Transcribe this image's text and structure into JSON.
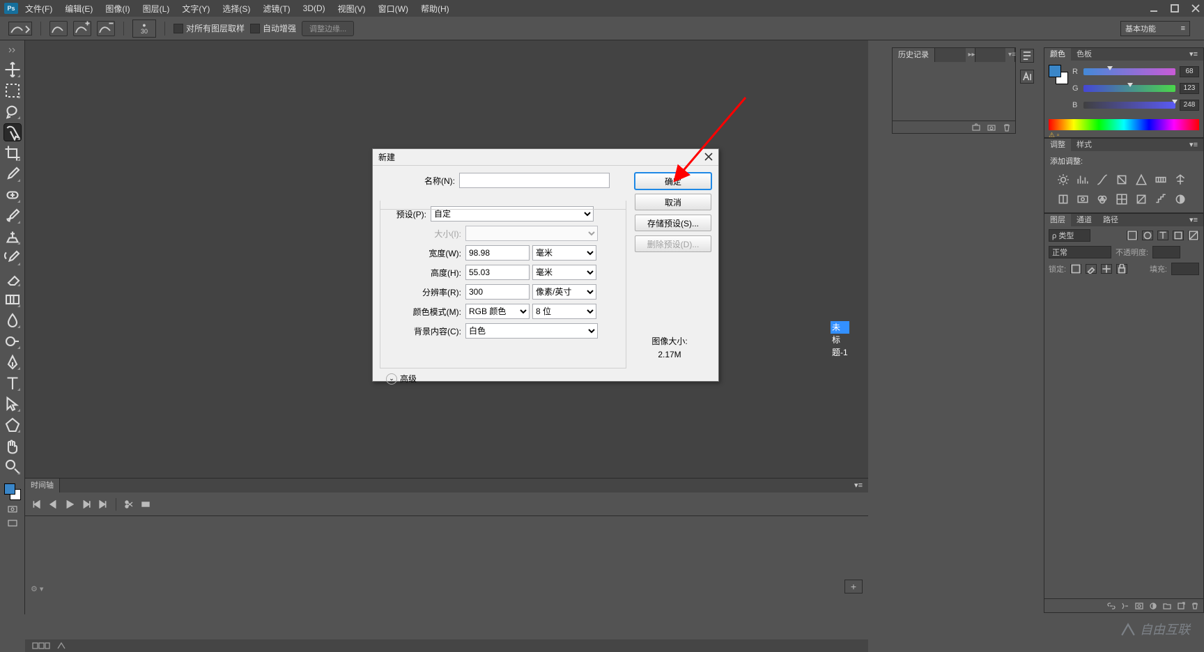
{
  "menubar": [
    "文件(F)",
    "编辑(E)",
    "图像(I)",
    "图层(L)",
    "文字(Y)",
    "选择(S)",
    "滤镜(T)",
    "3D(D)",
    "视图(V)",
    "窗口(W)",
    "帮助(H)"
  ],
  "optbar": {
    "size": "30",
    "chk1": "对所有图层取样",
    "chk2": "自动增强",
    "btn": "调整边缘...",
    "preset": "基本功能"
  },
  "history": {
    "title": "历史记录"
  },
  "color": {
    "tabs": [
      "颜色",
      "色板"
    ],
    "r": 68,
    "g": 123,
    "b": 248
  },
  "adjust": {
    "tabs": [
      "调整",
      "样式"
    ],
    "label": "添加调整:"
  },
  "layers": {
    "tabs": [
      "图层",
      "通道",
      "路径"
    ],
    "filter": "ρ 类型",
    "blend": "正常",
    "opacity_lbl": "不透明度:",
    "lock_lbl": "锁定:",
    "fill_lbl": "填充:"
  },
  "timeline": {
    "title": "时间轴"
  },
  "dialog": {
    "title": "新建",
    "name_lbl": "名称(N):",
    "name_val": "未标题-1",
    "preset_lbl": "预设(P):",
    "preset_val": "自定",
    "size_lbl": "大小(I):",
    "width_lbl": "宽度(W):",
    "width_val": "98.98",
    "width_unit": "毫米",
    "height_lbl": "高度(H):",
    "height_val": "55.03",
    "height_unit": "毫米",
    "res_lbl": "分辨率(R):",
    "res_val": "300",
    "res_unit": "像素/英寸",
    "mode_lbl": "颜色模式(M):",
    "mode_val": "RGB 颜色",
    "depth_val": "8 位",
    "bg_lbl": "背景内容(C):",
    "bg_val": "白色",
    "advanced": "高级",
    "imgsize_lbl": "图像大小:",
    "imgsize_val": "2.17M",
    "ok": "确定",
    "cancel": "取消",
    "save_preset": "存储预设(S)...",
    "del_preset": "删除预设(D)..."
  },
  "watermark": "自由互联"
}
